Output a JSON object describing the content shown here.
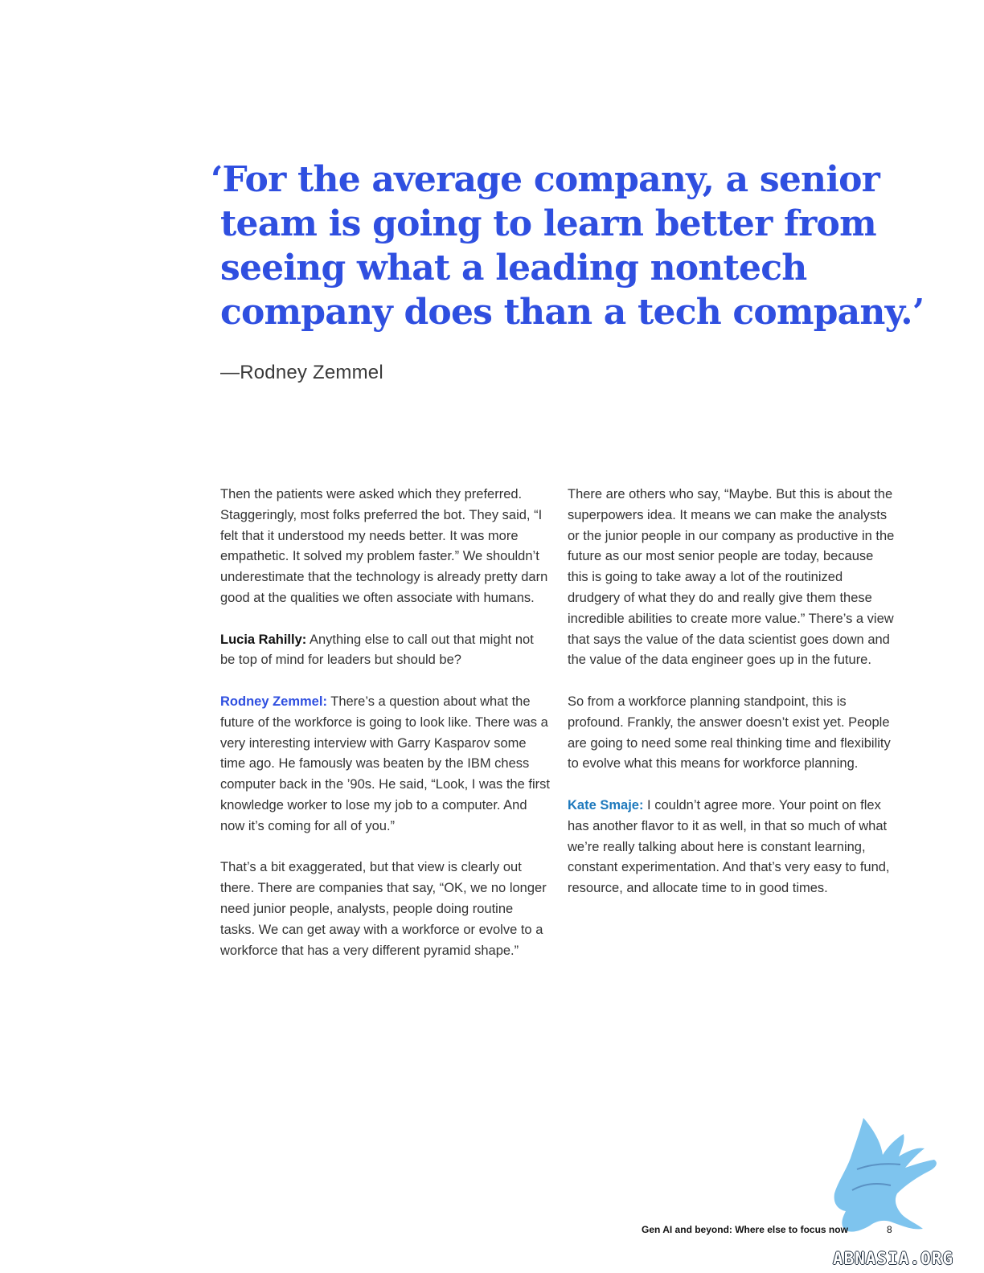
{
  "pull_quote": {
    "lines": [
      "‘For the average company, a senior",
      "team is going to learn better from",
      "seeing what a leading nontech",
      "company does than a tech company.’"
    ],
    "attribution": "—Rodney Zemmel"
  },
  "left_column": {
    "p1": "Then the patients were asked which they preferred. Staggeringly, most folks preferred the bot. They said, “I felt that it understood my needs better. It was more empathetic. It solved my problem faster.” We shouldn’t underestimate that the technology is already pretty darn good at the qualities we often associate with humans.",
    "p2_speaker": "Lucia Rahilly:",
    "p2_text": " Anything else to call out that might not be top of mind for leaders but should be?",
    "p3_speaker": "Rodney Zemmel:",
    "p3_text": " There’s a question about what the future of the workforce is going to look like. There was a very interesting interview with Garry Kasparov some time ago. He famously was beaten by the IBM chess computer back in the ’90s. He said, “Look, I was the first knowledge worker to lose my job to a computer. And now it’s coming for all of you.”",
    "p4": "That’s a bit exaggerated, but that view is clearly out there. There are companies that say, “OK, we no longer need junior people, analysts, people doing routine tasks. We can get away with a workforce or evolve to a workforce that has a very different pyramid shape.”"
  },
  "right_column": {
    "p1": "There are others who say, “Maybe. But this is about the superpowers idea. It means we can make the analysts or the junior people in our company as productive in the future as our most senior people are today, because this is going to take away a lot of the routinized drudgery of what they do and really give them these incredible abilities to create more value.” There’s a view that says the value of the data scientist goes down and the value of the data engineer goes up in the future.",
    "p2": "So from a workforce planning standpoint, this is profound. Frankly, the answer doesn’t exist yet. People are going to need some real thinking time and flexibility to evolve what this means for workforce planning.",
    "p3_speaker": "Kate Smaje:",
    "p3_text": " I couldn’t agree more. Your point on flex has another flavor to it as well, in that so much of what we’re really talking about here is constant learning, constant experimentation. And that’s very easy to fund, resource, and allocate time to in good times."
  },
  "footer": {
    "title": "Gen AI and beyond: Where else to focus now",
    "page_number": "8"
  },
  "watermark": {
    "text": "ABNASIA.ORG",
    "icon": "griffin-logo-icon",
    "color": "#7ec4ee"
  },
  "colors": {
    "quote": "#2f4fe0",
    "rodney": "#2f4fe0",
    "kate": "#1e79bd"
  }
}
